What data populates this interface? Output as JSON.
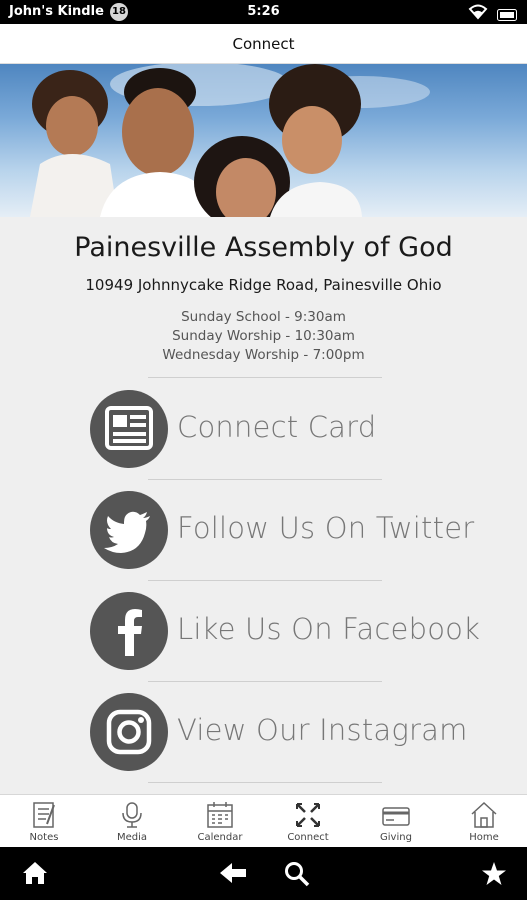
{
  "status_bar": {
    "device_name": "John's Kindle",
    "notification_count": "18",
    "time": "5:26"
  },
  "header": {
    "title": "Connect"
  },
  "church": {
    "name": "Painesville Assembly of God",
    "address": "10949 Johnnycake Ridge Road, Painesville Ohio",
    "service_times": [
      "Sunday School - 9:30am",
      "Sunday Worship - 10:30am",
      "Wednesday Worship - 7:00pm"
    ]
  },
  "links": [
    {
      "label": "Connect Card",
      "icon": "connect-card-icon"
    },
    {
      "label": "Follow Us On Twitter",
      "icon": "twitter-icon"
    },
    {
      "label": "Like Us On Facebook",
      "icon": "facebook-icon"
    },
    {
      "label": "View Our Instagram",
      "icon": "instagram-icon"
    }
  ],
  "tabs": [
    {
      "label": "Notes",
      "icon": "notes-icon"
    },
    {
      "label": "Media",
      "icon": "microphone-icon"
    },
    {
      "label": "Calendar",
      "icon": "calendar-icon"
    },
    {
      "label": "Connect",
      "icon": "connect-icon",
      "active": true
    },
    {
      "label": "Giving",
      "icon": "credit-card-icon"
    },
    {
      "label": "Home",
      "icon": "home-icon"
    }
  ],
  "colors": {
    "icon_circle": "#555555",
    "link_text": "#777777",
    "background": "#efefef"
  }
}
